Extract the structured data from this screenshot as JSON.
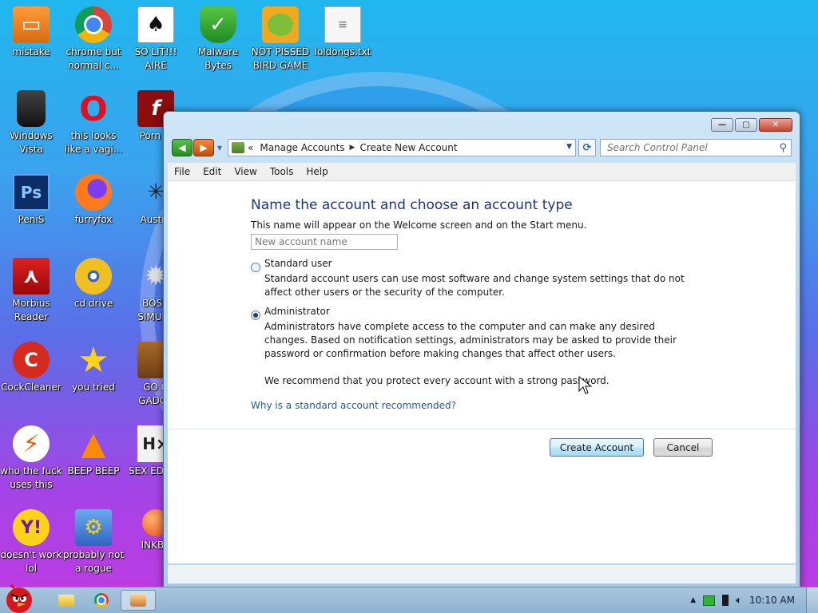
{
  "desktop": {
    "icons": [
      {
        "label": "mistake",
        "icon": "monitor-icon"
      },
      {
        "label": "chrome but normal c...",
        "icon": "chrome-icon"
      },
      {
        "label": "SO LIT!!! AIRE",
        "icon": "solitaire-icon"
      },
      {
        "label": "Malware Bytes",
        "icon": "shield-icon"
      },
      {
        "label": "NOT PISSED BIRD GAME",
        "icon": "pig-icon"
      },
      {
        "label": "loldongs.txt",
        "icon": "text-file-icon"
      },
      {
        "label": "Windows Vista",
        "icon": "recycle-bin-icon"
      },
      {
        "label": "this looks like a vagi...",
        "icon": "opera-icon"
      },
      {
        "label": "Porn Pl",
        "icon": "flash-icon"
      },
      {
        "label": "PeniS",
        "icon": "photoshop-icon"
      },
      {
        "label": "furryfox",
        "icon": "firefox-icon"
      },
      {
        "label": "Austra",
        "icon": "spider-solitaire-icon"
      },
      {
        "label": "Morbius Reader",
        "icon": "pdf-reader-icon"
      },
      {
        "label": "cd drive",
        "icon": "cd-drive-icon"
      },
      {
        "label": "BOSN SIMULA",
        "icon": "gear-ball-icon"
      },
      {
        "label": "CockCleaner",
        "icon": "ccleaner-icon"
      },
      {
        "label": "you tried",
        "icon": "star-icon"
      },
      {
        "label": "GO G GADGE",
        "icon": "briefcase-icon"
      },
      {
        "label": "who the fuck uses this",
        "icon": "lightning-icon"
      },
      {
        "label": "BEEP BEEP",
        "icon": "vlc-cone-icon"
      },
      {
        "label": "SEX EDITIO",
        "icon": "hex-editor-icon"
      },
      {
        "label": "doesn't work lol",
        "icon": "yahoo-messenger-icon"
      },
      {
        "label": "probably not a rogue",
        "icon": "system-tool-icon"
      },
      {
        "label": "INKBA",
        "icon": "pushpin-icon"
      }
    ]
  },
  "window": {
    "breadcrumb": [
      "Manage Accounts",
      "Create New Account"
    ],
    "breadcrumb_prefix": "«",
    "search_placeholder": "Search Control Panel",
    "menu": [
      "File",
      "Edit",
      "View",
      "Tools",
      "Help"
    ],
    "heading": "Name the account and choose an account type",
    "description": "This name will appear on the Welcome screen and on the Start menu.",
    "name_placeholder": "New account name",
    "options": [
      {
        "label": "Standard user",
        "selected": false,
        "desc": "Standard account users can use most software and change system settings that do not affect other users or the security of the computer."
      },
      {
        "label": "Administrator",
        "selected": true,
        "desc": "Administrators have complete access to the computer and can make any desired changes. Based on notification settings, administrators may be asked to provide their password or confirmation before making changes that affect other users."
      }
    ],
    "recommendation": "We recommend that you protect every account with a strong password.",
    "help_link": "Why is a standard account recommended?",
    "create_button": "Create Account",
    "cancel_button": "Cancel"
  },
  "taskbar": {
    "clock": "10:10 AM"
  },
  "colors": {
    "heading": "#1e3287",
    "link": "#1c5ba6"
  }
}
